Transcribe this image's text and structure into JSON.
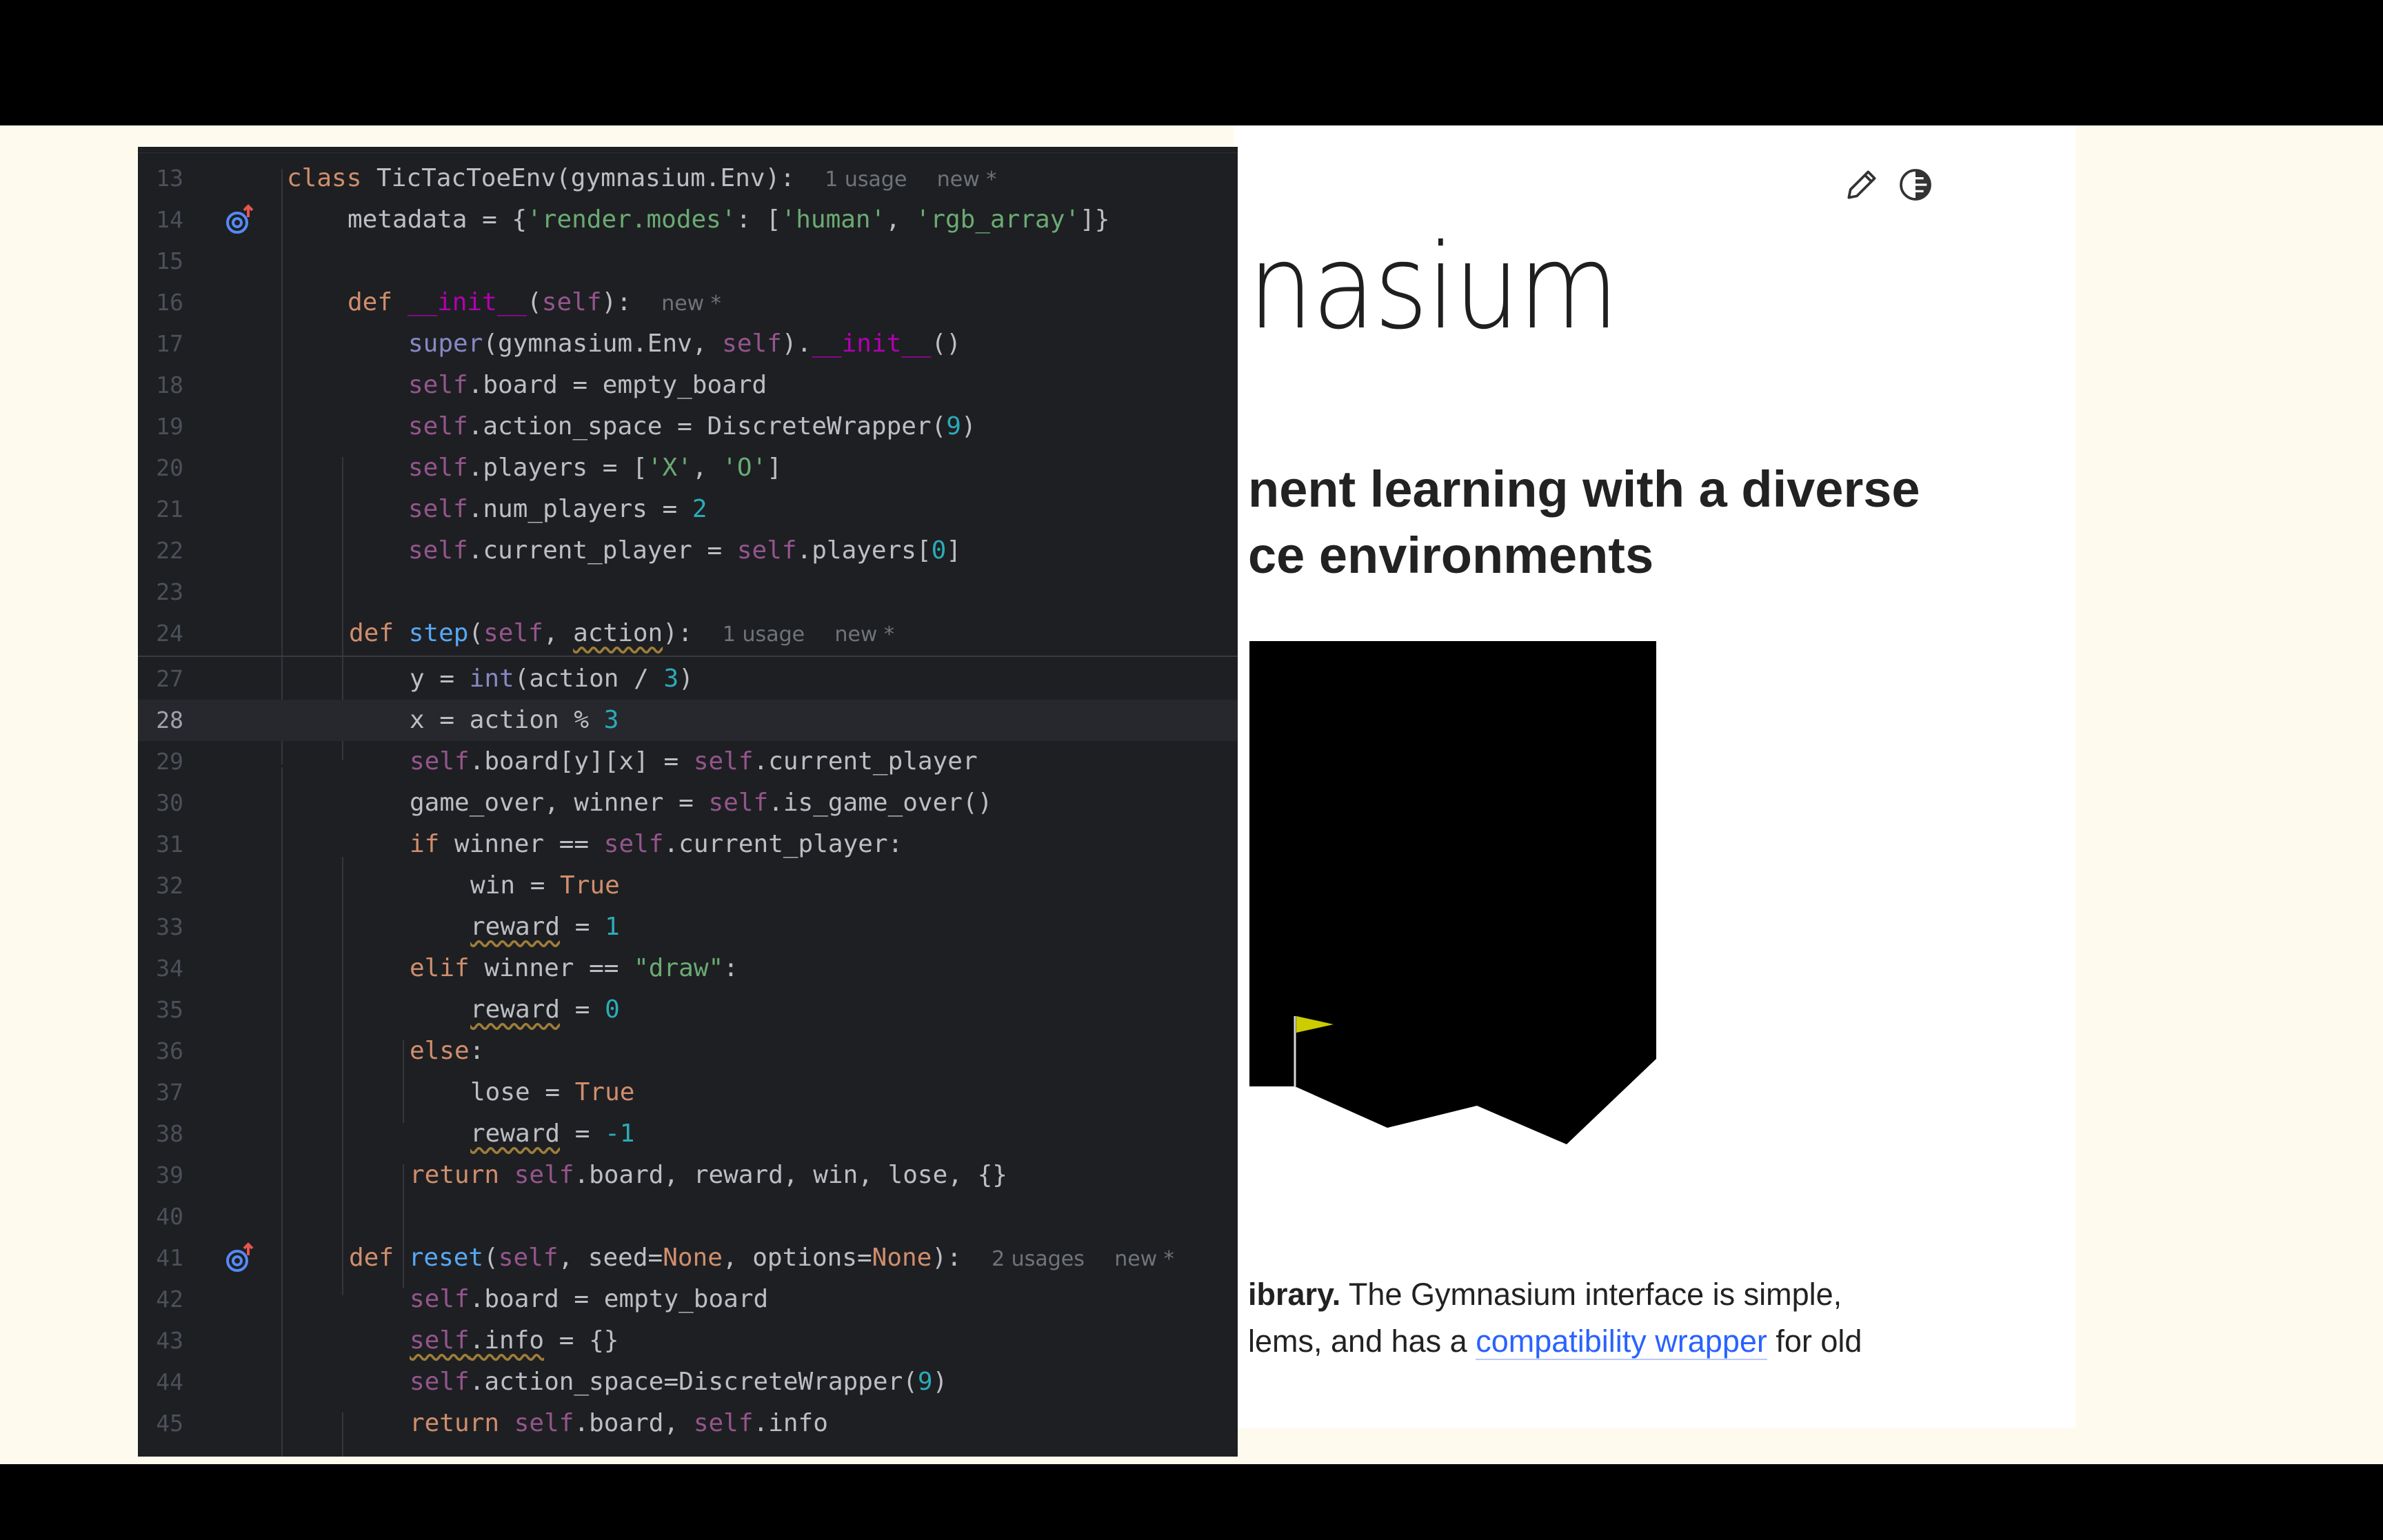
{
  "website": {
    "title_partial": "nasium",
    "subtitle_lines": [
      "nent learning with a diverse",
      "ce environments"
    ],
    "body_line1_bold": "ibrary.",
    "body_line1_rest": " The Gymnasium interface is simple,",
    "body_line2_prefix": "lems, and has a ",
    "body_line2_link": "compatibility wrapper",
    "body_line2_suffix": " for old",
    "icons": [
      "edit-icon",
      "theme-toggle-icon"
    ]
  },
  "editor": {
    "hints": {
      "one_usage": "1 usage",
      "two_usages": "2 usages",
      "new": "new *"
    },
    "line_numbers": [
      "13",
      "14",
      "15",
      "16",
      "17",
      "18",
      "19",
      "20",
      "21",
      "22",
      "23",
      "24",
      "27",
      "28",
      "29",
      "30",
      "31",
      "32",
      "33",
      "34",
      "35",
      "36",
      "37",
      "38",
      "39",
      "40",
      "41",
      "42",
      "43",
      "44",
      "45"
    ],
    "current_line": "28",
    "colors": {
      "background": "#1e1f22",
      "keyword": "#cf8e6d",
      "function": "#56a8f5",
      "self": "#94558d",
      "string": "#6aab73",
      "number": "#2aacb8"
    }
  }
}
